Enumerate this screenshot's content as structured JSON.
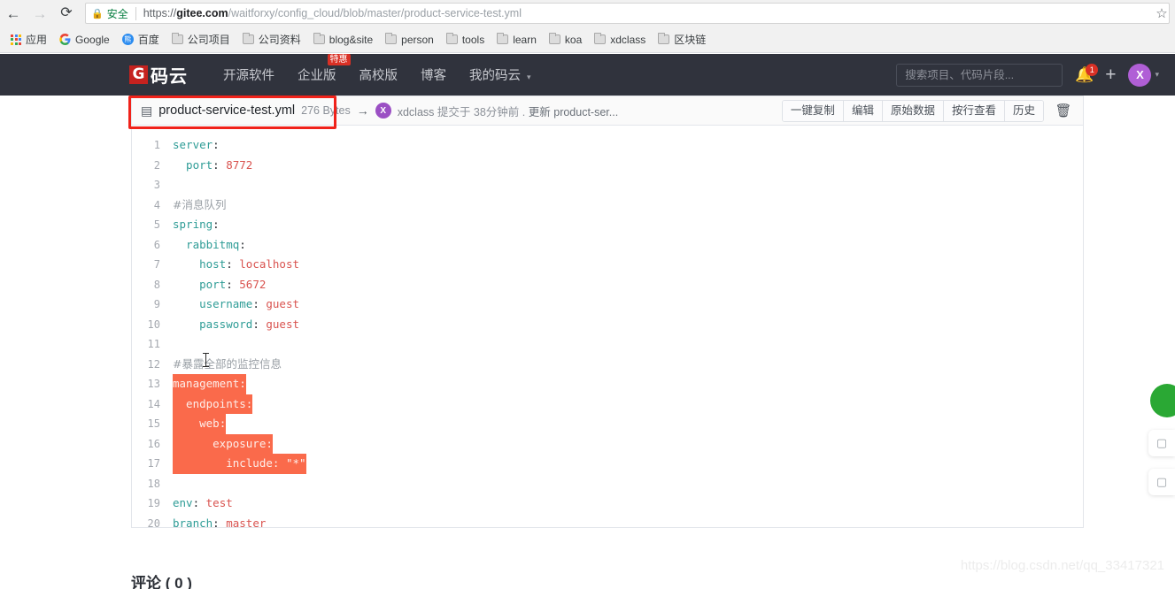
{
  "browser": {
    "back_icon": "arrow-left-icon",
    "forward_icon": "arrow-right-icon",
    "reload_icon": "reload-icon",
    "secure_label": "安全",
    "lock_icon": "lock-icon",
    "url_scheme": "https://",
    "url_domain": "gitee.com",
    "url_path": "/waitforxy/config_cloud/blob/master/product-service-test.yml",
    "url_full": "https://gitee.com/waitforxy/config_cloud/blob/master/product-service-test.yml",
    "star_icon": "star-icon"
  },
  "bookmarks": [
    {
      "label": "应用",
      "icon": "apps-grid-icon"
    },
    {
      "label": "Google",
      "icon": "google-icon"
    },
    {
      "label": "百度",
      "icon": "baidu-icon"
    },
    {
      "label": "公司项目",
      "icon": "folder-icon"
    },
    {
      "label": "公司资料",
      "icon": "folder-icon"
    },
    {
      "label": "blog&site",
      "icon": "folder-icon"
    },
    {
      "label": "person",
      "icon": "folder-icon"
    },
    {
      "label": "tools",
      "icon": "folder-icon"
    },
    {
      "label": "learn",
      "icon": "folder-icon"
    },
    {
      "label": "koa",
      "icon": "folder-icon"
    },
    {
      "label": "xdclass",
      "icon": "folder-icon"
    },
    {
      "label": "区块链",
      "icon": "folder-icon"
    }
  ],
  "header": {
    "logo_mark": "G",
    "logo_text": "码云",
    "nav": [
      {
        "label": "开源软件",
        "badge": ""
      },
      {
        "label": "企业版",
        "badge": "特惠"
      },
      {
        "label": "高校版",
        "badge": ""
      },
      {
        "label": "博客",
        "badge": ""
      },
      {
        "label": "我的码云",
        "badge": "",
        "caret": "▾"
      }
    ],
    "search_placeholder": "搜索项目、代码片段...",
    "search_value": "",
    "bell_icon": "bell-icon",
    "bell_count": "1",
    "plus_icon": "plus-icon",
    "avatar_initial": "X",
    "avatar_caret": "▾",
    "bg_color": "#30333d",
    "brand_red": "#c5221f",
    "avatar_color": "#b05fd6"
  },
  "file_bar": {
    "file_icon": "file-text-icon",
    "file_name": "product-service-test.yml",
    "file_size": "276 Bytes",
    "arrow_icon": "arrow-right-icon",
    "author_avatar_initial": "X",
    "author": "xdclass",
    "commit_prefix": "提交于",
    "commit_time": "38分钟前",
    "commit_sep": ".",
    "commit_message": "更新 product-ser...",
    "actions": [
      "一键复制",
      "编辑",
      "原始数据",
      "按行查看",
      "历史"
    ],
    "delete_icon": "trash-icon"
  },
  "code": {
    "language": "yaml",
    "highlight_color": "#fa6a4b",
    "lines": [
      {
        "n": "1",
        "highlight": false,
        "tokens": [
          {
            "t": "server",
            "c": "tok-key"
          },
          {
            "t": ":",
            "c": "tok-punct"
          }
        ]
      },
      {
        "n": "2",
        "highlight": false,
        "tokens": [
          {
            "t": "  port",
            "c": "tok-key"
          },
          {
            "t": ": ",
            "c": "tok-punct"
          },
          {
            "t": "8772",
            "c": "tok-num"
          }
        ]
      },
      {
        "n": "3",
        "highlight": false,
        "tokens": [
          {
            "t": "",
            "c": "tok-punct"
          }
        ]
      },
      {
        "n": "4",
        "highlight": false,
        "tokens": [
          {
            "t": "#消息队列",
            "c": "tok-comment"
          }
        ]
      },
      {
        "n": "5",
        "highlight": false,
        "tokens": [
          {
            "t": "spring",
            "c": "tok-key"
          },
          {
            "t": ":",
            "c": "tok-punct"
          }
        ]
      },
      {
        "n": "6",
        "highlight": false,
        "tokens": [
          {
            "t": "  rabbitmq",
            "c": "tok-key"
          },
          {
            "t": ":",
            "c": "tok-punct"
          }
        ]
      },
      {
        "n": "7",
        "highlight": false,
        "tokens": [
          {
            "t": "    host",
            "c": "tok-key"
          },
          {
            "t": ": ",
            "c": "tok-punct"
          },
          {
            "t": "localhost",
            "c": "tok-val"
          }
        ]
      },
      {
        "n": "8",
        "highlight": false,
        "tokens": [
          {
            "t": "    port",
            "c": "tok-key"
          },
          {
            "t": ": ",
            "c": "tok-punct"
          },
          {
            "t": "5672",
            "c": "tok-num"
          }
        ]
      },
      {
        "n": "9",
        "highlight": false,
        "tokens": [
          {
            "t": "    username",
            "c": "tok-key"
          },
          {
            "t": ": ",
            "c": "tok-punct"
          },
          {
            "t": "guest",
            "c": "tok-val"
          }
        ]
      },
      {
        "n": "10",
        "highlight": false,
        "tokens": [
          {
            "t": "    password",
            "c": "tok-key"
          },
          {
            "t": ": ",
            "c": "tok-punct"
          },
          {
            "t": "guest",
            "c": "tok-val"
          }
        ]
      },
      {
        "n": "11",
        "highlight": false,
        "tokens": [
          {
            "t": "",
            "c": "tok-punct"
          }
        ]
      },
      {
        "n": "12",
        "highlight": false,
        "tokens": [
          {
            "t": "#暴露全部的监控信息",
            "c": "tok-comment"
          }
        ]
      },
      {
        "n": "13",
        "highlight": true,
        "tokens": [
          {
            "t": "management",
            "c": "tok-key"
          },
          {
            "t": ":",
            "c": "tok-punct"
          }
        ]
      },
      {
        "n": "14",
        "highlight": true,
        "tokens": [
          {
            "t": "  endpoints",
            "c": "tok-key"
          },
          {
            "t": ":",
            "c": "tok-punct"
          }
        ]
      },
      {
        "n": "15",
        "highlight": true,
        "tokens": [
          {
            "t": "    web",
            "c": "tok-key"
          },
          {
            "t": ":",
            "c": "tok-punct"
          }
        ]
      },
      {
        "n": "16",
        "highlight": true,
        "tokens": [
          {
            "t": "      exposure",
            "c": "tok-key"
          },
          {
            "t": ":",
            "c": "tok-punct"
          }
        ]
      },
      {
        "n": "17",
        "highlight": true,
        "tokens": [
          {
            "t": "        include",
            "c": "tok-key"
          },
          {
            "t": ": ",
            "c": "tok-punct"
          },
          {
            "t": "\"*\"",
            "c": "tok-val"
          }
        ]
      },
      {
        "n": "18",
        "highlight": false,
        "tokens": [
          {
            "t": "",
            "c": "tok-punct"
          }
        ]
      },
      {
        "n": "19",
        "highlight": false,
        "tokens": [
          {
            "t": "env",
            "c": "tok-key"
          },
          {
            "t": ": ",
            "c": "tok-punct"
          },
          {
            "t": "test",
            "c": "tok-val"
          }
        ]
      },
      {
        "n": "20",
        "highlight": false,
        "tokens": [
          {
            "t": "branch",
            "c": "tok-key"
          },
          {
            "t": ": ",
            "c": "tok-punct"
          },
          {
            "t": "master",
            "c": "tok-val"
          }
        ]
      }
    ]
  },
  "annotation": {
    "shape": "rectangle",
    "color": "#f0221a",
    "target": "product-service-test.yml"
  },
  "float_widgets": [
    {
      "name": "scroll-top-button",
      "icon": "arrow-up-icon",
      "glyph": "▲",
      "color": "#2aa834"
    },
    {
      "name": "feedback-chip",
      "icon": "comment-icon",
      "glyph": "▢"
    },
    {
      "name": "qrcode-chip",
      "icon": "qrcode-icon",
      "glyph": "▢"
    }
  ],
  "comments": {
    "title": "评论 ( 0 )",
    "count": "0"
  },
  "watermark": {
    "text": "https://blog.csdn.net/qq_33417321"
  }
}
